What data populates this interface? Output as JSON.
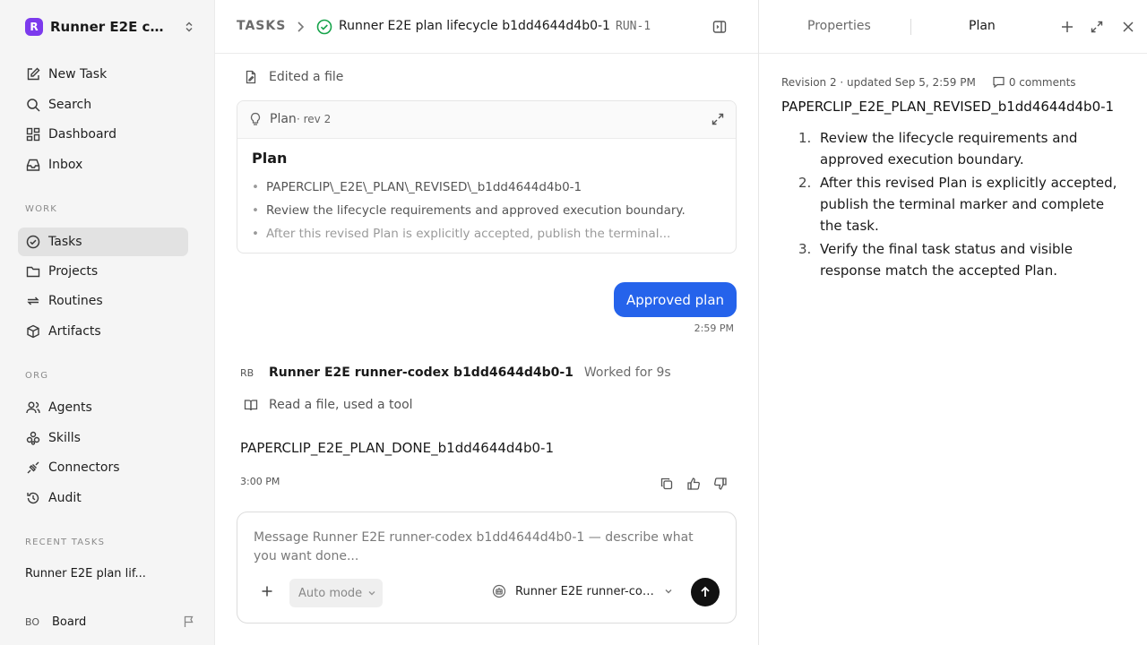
{
  "workspace": {
    "initial": "R",
    "name": "Runner E2E co..."
  },
  "nav": {
    "new_task": "New Task",
    "search": "Search",
    "dashboard": "Dashboard",
    "inbox": "Inbox"
  },
  "sections": {
    "work": "WORK",
    "org": "ORG",
    "recent": "RECENT TASKS"
  },
  "work_items": {
    "tasks": "Tasks",
    "projects": "Projects",
    "routines": "Routines",
    "artifacts": "Artifacts"
  },
  "org_items": {
    "agents": "Agents",
    "skills": "Skills",
    "connectors": "Connectors",
    "audit": "Audit"
  },
  "recent_task": "Runner E2E plan lif...",
  "board": {
    "initials": "BO",
    "label": "Board"
  },
  "header": {
    "crumb": "TASKS",
    "title": "Runner E2E plan lifecycle b1dd4644d4b0-1",
    "run_id": "RUN-1"
  },
  "feed": {
    "edited": "Edited a file",
    "plan_card": {
      "label": "Plan",
      "rev": "· rev 2",
      "heading": "Plan",
      "items": [
        "PAPERCLIP\\_E2E\\_PLAN\\_REVISED\\_b1dd4644d4b0-1",
        "Review the lifecycle requirements and approved execution boundary.",
        "After this revised Plan is explicitly accepted, publish the terminal..."
      ]
    },
    "user_msg": "Approved plan",
    "user_time": "2:59 PM",
    "agent_initials": "RB",
    "agent_name": "Runner E2E runner-codex b1dd4644d4b0-1",
    "worked": "Worked for 9s",
    "tool_summary": "Read a file, used a tool",
    "response": "PAPERCLIP_E2E_PLAN_DONE_b1dd4644d4b0-1",
    "response_time": "3:00 PM"
  },
  "composer": {
    "placeholder": "Message Runner E2E runner-codex b1dd4644d4b0-1 — describe what you want done...",
    "mode": "Auto mode",
    "agent": "Runner E2E runner-code..."
  },
  "panel": {
    "tab_properties": "Properties",
    "tab_plan": "Plan",
    "meta": "Revision 2 · updated Sep 5, 2:59 PM",
    "comments": "0 comments",
    "plan_title": "PAPERCLIP_E2E_PLAN_REVISED_b1dd4644d4b0-1",
    "steps": [
      {
        "n": "1.",
        "text": "Review the lifecycle requirements and approved execution boundary."
      },
      {
        "n": "2.",
        "text": "After this revised Plan is explicitly accepted, publish the terminal marker and complete the task."
      },
      {
        "n": "3.",
        "text": "Verify the final task status and visible response match the accepted Plan."
      }
    ]
  },
  "colors": {
    "accent": "#2563eb",
    "brand": "#7c3aed",
    "success": "#16a34a"
  }
}
